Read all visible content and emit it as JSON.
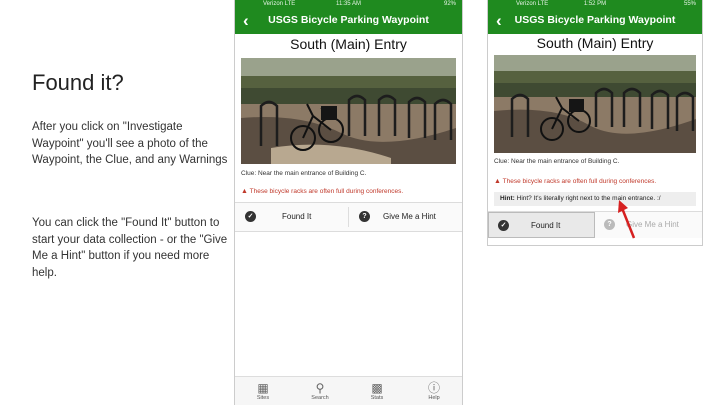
{
  "slide": {
    "title": "Found it?",
    "paragraph1": "After you click on \"Investigate Waypoint\" you'll see a photo of the Waypoint, the Clue, and any Warnings",
    "paragraph2": "You can click the \"Found It\" button to start your data collection - or the \"Give Me a Hint\" button if you need more help."
  },
  "phone1": {
    "status": {
      "carrier": "Verizon LTE",
      "time": "11:35 AM",
      "battery": "92%"
    },
    "app_title": "USGS Bicycle Parking Waypoint",
    "waypoint_title": "South (Main) Entry",
    "clue": "Clue: Near the main entrance of Building C.",
    "warning": "These bicycle racks are often full during conferences.",
    "found_button": "Found It",
    "hint_button": "Give Me a Hint",
    "tabs": [
      {
        "label": "Sites",
        "icon": "map-icon"
      },
      {
        "label": "Search",
        "icon": "search-icon"
      },
      {
        "label": "Stats",
        "icon": "bar-chart-icon"
      },
      {
        "label": "Help",
        "icon": "help-icon"
      }
    ]
  },
  "phone2": {
    "status": {
      "carrier": "Verizon LTE",
      "time": "1:52 PM",
      "battery": "55%"
    },
    "app_title": "USGS Bicycle Parking Waypoint",
    "waypoint_title": "South (Main) Entry",
    "clue": "Clue: Near the main entrance of Building C.",
    "warning": "These bicycle racks are often full during conferences.",
    "hint_label": "Hint:",
    "hint_text": "Hint? It's literally right next to the main entrance. :/",
    "found_button": "Found It",
    "hint_button": "Give Me a Hint"
  },
  "colors": {
    "appbar": "#1f8a1f",
    "warning": "#c0392b",
    "arrow": "#d62020"
  }
}
